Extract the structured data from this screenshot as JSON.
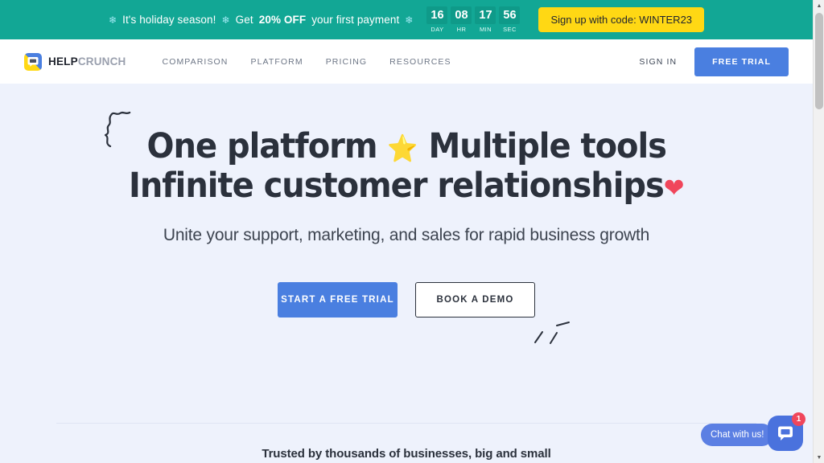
{
  "promo": {
    "snowflake_icon": "❄",
    "text_1": "It's holiday season!",
    "text_2_pre": "Get",
    "text_2_strong": "20% OFF",
    "text_2_post": "your first payment",
    "countdown": [
      {
        "value": "16",
        "label": "DAY"
      },
      {
        "value": "08",
        "label": "HR"
      },
      {
        "value": "17",
        "label": "MIN"
      },
      {
        "value": "56",
        "label": "SEC"
      }
    ],
    "cta_label": "Sign up with code: WINTER23",
    "bg_color": "#12a795",
    "cta_color": "#ffd814"
  },
  "nav": {
    "logo": {
      "name_bold": "HELP",
      "name_light": "CRUNCH"
    },
    "links": [
      {
        "label": "COMPARISON"
      },
      {
        "label": "PLATFORM"
      },
      {
        "label": "PRICING"
      },
      {
        "label": "RESOURCES"
      }
    ],
    "sign_in_label": "SIGN IN",
    "free_trial_label": "FREE TRIAL",
    "accent_color": "#4a7fe0"
  },
  "hero": {
    "headline_line1": "One platform",
    "headline_star": "⭐",
    "headline_line1_b": "Multiple tools",
    "headline_line2": "Infinite customer relationships",
    "headline_heart": "❤",
    "subheadline": "Unite your support, marketing, and sales for rapid business growth",
    "primary_cta": "START A FREE TRIAL",
    "secondary_cta": "BOOK A DEMO",
    "background_color": "#eef2fc"
  },
  "trusted": {
    "text": "Trusted by thousands of businesses, big and small"
  },
  "chat": {
    "prompt": "Chat with us!",
    "badge_count": "1",
    "launcher_icon": "chat-bubble-icon",
    "color": "#4a72dd",
    "badge_color": "#f0465b"
  },
  "scrollbar": {
    "up_arrow": "▲",
    "down_arrow": "▼"
  }
}
